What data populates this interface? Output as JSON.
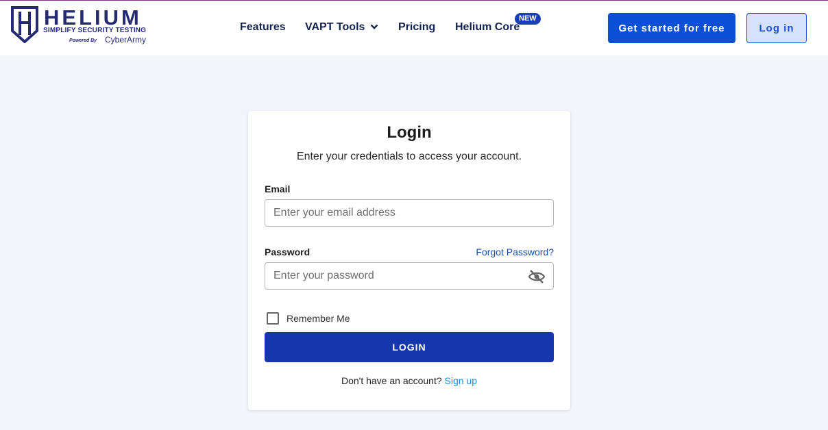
{
  "brand": {
    "name": "HELIUM",
    "tagline": "SIMPLIFY SECURITY TESTING",
    "powered_by": "Powered By",
    "partner": "CyberArmy",
    "color": "#262a72"
  },
  "nav": {
    "items": [
      {
        "label": "Features"
      },
      {
        "label": "VAPT Tools"
      },
      {
        "label": "Pricing"
      },
      {
        "label": "Helium Core"
      }
    ],
    "new_badge": "NEW",
    "get_started_label": "Get started for free",
    "login_label": "Log in"
  },
  "login_card": {
    "title": "Login",
    "subtitle": "Enter your credentials to access your account.",
    "email_label": "Email",
    "email_placeholder": "Enter your email address",
    "password_label": "Password",
    "password_placeholder": "Enter your password",
    "forgot_password": "Forgot Password?",
    "remember_me": "Remember Me",
    "login_button": "LOGIN",
    "no_account_text": "Don't have an account?",
    "sign_up_link": "Sign up"
  },
  "colors": {
    "accent": "#0a4fd6",
    "login_button": "#1537ab",
    "background": "#f3f5fc",
    "link": "#1a8ce0"
  },
  "icons": {
    "vapt_dropdown": "chevron-down-icon",
    "password_toggle": "eye-off-icon"
  }
}
